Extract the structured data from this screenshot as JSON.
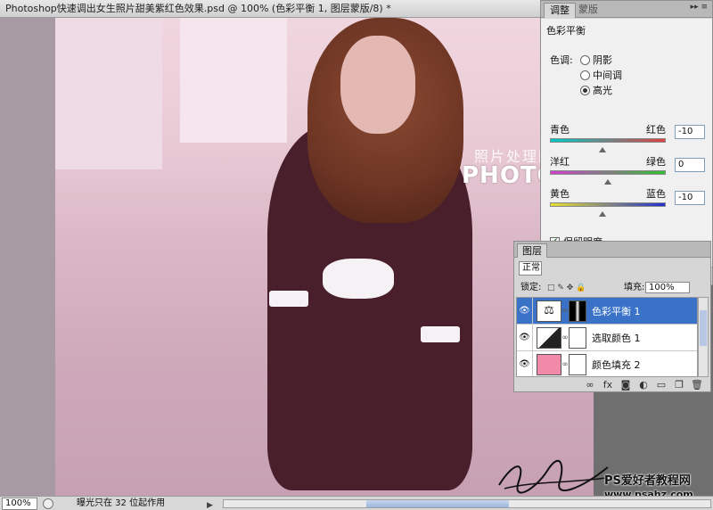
{
  "document": {
    "title": "Photoshop快速调出女生照片甜美紫红色效果.psd @ 100% (色彩平衡 1, 图层蒙版/8) *",
    "watermark_line1": "照片处理网",
    "watermark_line2": "PHOTOPS.COM",
    "site_mark_line1": "PS爱好者教程网",
    "site_mark_line2": "www.psahz.com"
  },
  "statusbar": {
    "zoom": "100%",
    "message": "曝光只在 32 位起作用"
  },
  "adjustments": {
    "tabs": [
      "调整",
      "蒙版"
    ],
    "title": "色彩平衡",
    "tone_label": "色调:",
    "tone_options": [
      "阴影",
      "中间调",
      "高光"
    ],
    "selected_tone": "高光",
    "sliders": [
      {
        "left": "青色",
        "right": "红色",
        "value": "-10",
        "level": -10
      },
      {
        "left": "洋红",
        "right": "绿色",
        "value": "0",
        "level": 0
      },
      {
        "left": "黄色",
        "right": "蓝色",
        "value": "-10",
        "level": -10
      }
    ],
    "preserve_luminosity": "保留明度",
    "preserve_checked": true
  },
  "layers": {
    "tab": "图层",
    "blend_mode": "正常",
    "lock_label": "锁定:",
    "fill_label": "填充:",
    "fill_value": "100%",
    "items": [
      {
        "name": "色彩平衡 1",
        "selected": true,
        "thumb": "balance-scale-icon"
      },
      {
        "name": "选取颜色 1",
        "selected": false,
        "thumb": "selective-color-icon"
      },
      {
        "name": "颜色填充 2",
        "selected": false,
        "thumb": "color-fill-swatch",
        "swatch": "#f08aa8"
      }
    ]
  },
  "colors": {
    "selection": "#3a72c8",
    "photo_tint": "#d9b7c6"
  }
}
